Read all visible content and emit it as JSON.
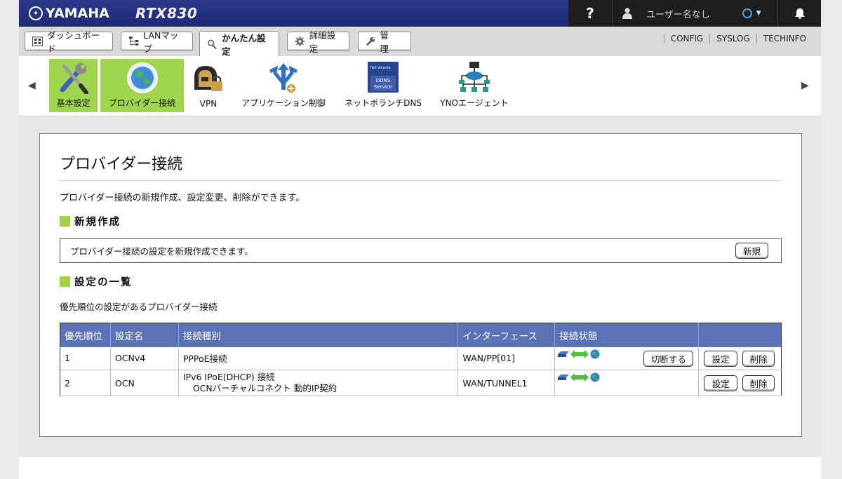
{
  "brand": {
    "logo": "YAMAHA",
    "model": "RTX830"
  },
  "topbar": {
    "help": "?",
    "user_name": "ユーザー名なし"
  },
  "tabs": [
    {
      "label": "ダッシュボード",
      "icon": "dashboard-icon"
    },
    {
      "label": "LANマップ",
      "icon": "lan-map-icon"
    },
    {
      "label": "かんたん設定",
      "icon": "wand-icon",
      "active": true
    },
    {
      "label": "詳細設定",
      "icon": "gear-icon"
    },
    {
      "label": "管　理",
      "icon": "wrench-icon"
    }
  ],
  "top_links": [
    "CONFIG",
    "SYSLOG",
    "TECHINFO"
  ],
  "apps": [
    {
      "label": "基本設定",
      "icon": "tools-icon",
      "selected": true
    },
    {
      "label": "プロバイダー接続",
      "icon": "globe-icon",
      "selected": true
    },
    {
      "label": "VPN",
      "icon": "vpn-lock-icon"
    },
    {
      "label": "アプリケーション制御",
      "icon": "app-control-icon"
    },
    {
      "label": "ネットボランチDNS",
      "icon": "ddns-icon",
      "icon_text": [
        "Net",
        "Volante",
        "DDNS",
        "Service"
      ]
    },
    {
      "label": "YNOエージェント",
      "icon": "network-icon"
    }
  ],
  "page": {
    "title": "プロバイダー接続",
    "description": "プロバイダー接続の新規作成、設定変更、削除ができます。",
    "new_section": {
      "heading": "新規作成",
      "text": "プロバイダー接続の設定を新規作成できます。",
      "button": "新規"
    },
    "list_section": {
      "heading": "設定の一覧",
      "note": "優先順位の設定があるプロバイダー接続"
    }
  },
  "table": {
    "headers": [
      "優先順位",
      "設定名",
      "接続種別",
      "インターフェース",
      "接続状態",
      ""
    ],
    "rows": [
      {
        "priority": "1",
        "name": "OCNv4",
        "type": "PPPoE接続",
        "type_sub": "",
        "interface": "WAN/PP[01]",
        "disconnect": "切断する",
        "edit": "設定",
        "delete": "削除"
      },
      {
        "priority": "2",
        "name": "OCN",
        "type": "IPv6 IPoE(DHCP) 接続",
        "type_sub": "OCNバーチャルコネクト 動的IP契約",
        "interface": "WAN/TUNNEL1",
        "disconnect": "",
        "edit": "設定",
        "delete": "削除"
      }
    ]
  },
  "colors": {
    "accent_green": "#9fd44d",
    "header_blue": "#5b73b6",
    "topbar_navy": "#243282"
  }
}
